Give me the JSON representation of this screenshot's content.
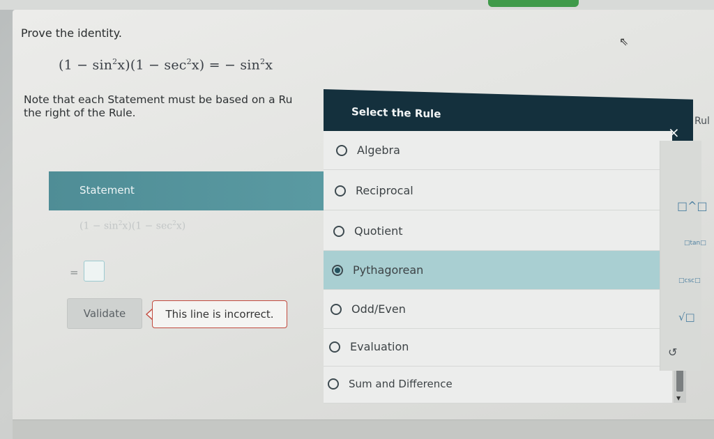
{
  "problem": {
    "prompt": "Prove the identity.",
    "equation": "(1 − sin²x)(1 − sec²x) = −sin²x",
    "note_line1": "Note that each Statement must be based on a Ru",
    "note_line2": "the right of the Rule."
  },
  "work": {
    "statement_header": "Statement",
    "statement_row": "(1 − sin²x)(1 − sec²x)",
    "equals": "=",
    "validate_label": "Validate",
    "error_message": "This line is incorrect."
  },
  "modal": {
    "title": "Select the Rule",
    "close_label": "×",
    "selected": "Pythagorean",
    "options": [
      "Algebra",
      "Reciprocal",
      "Quotient",
      "Pythagorean",
      "Odd/Even",
      "Evaluation",
      "Sum and Difference"
    ]
  },
  "side_panel": {
    "rule_tab": "Rul",
    "buttons": [
      "□^□",
      "□tan□",
      "□csc□",
      "√□"
    ],
    "undo": "↺"
  },
  "colors": {
    "modal_header": "#14303d",
    "statement_header": "#5a9aa2",
    "selected_option": "#a9cfd2",
    "error_border": "#c24a3e"
  }
}
